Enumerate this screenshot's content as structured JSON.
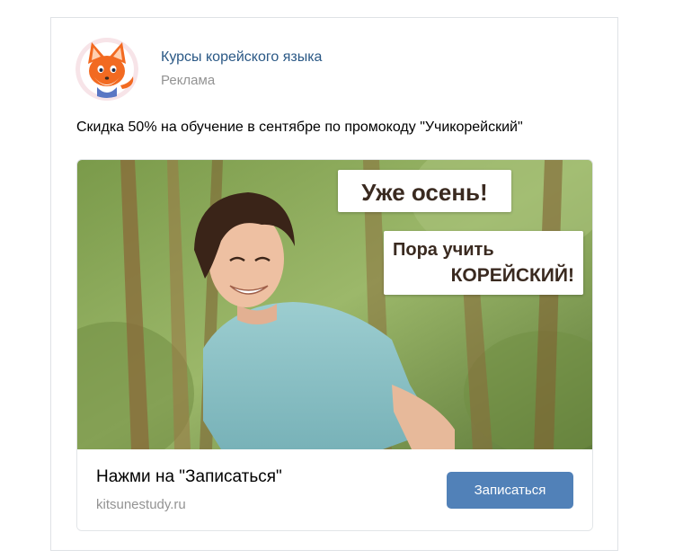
{
  "post": {
    "group_name": "Курсы корейского языка",
    "ad_label": "Реклама",
    "text": "Скидка 50% на обучение в сентябре по промокоду \"Учикорейский\""
  },
  "promo": {
    "image_banner_1": "Уже осень!",
    "image_banner_2_line1": "Пора учить",
    "image_banner_2_line2": "КОРЕЙСКИЙ!",
    "title": "Нажми на \"Записаться\"",
    "domain": "kitsunestudy.ru",
    "cta_label": "Записаться"
  },
  "colors": {
    "link": "#2a5885",
    "muted": "#939393",
    "button": "#5181b8",
    "border": "#dfe2e6"
  },
  "icons": {
    "avatar": "fox-mascot-icon"
  }
}
